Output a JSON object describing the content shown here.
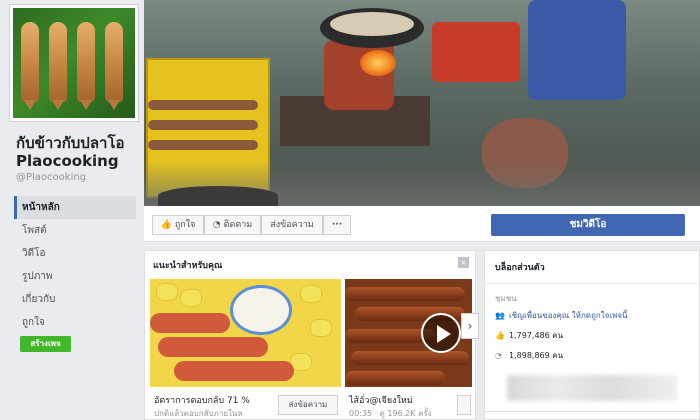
{
  "page": {
    "title": "กับข้าวกับปลาโอ Plaocooking",
    "handle": "@Plaocooking"
  },
  "sidebar": {
    "items": [
      {
        "label": "หน้าหลัก",
        "active": true
      },
      {
        "label": "โพสต์",
        "active": false
      },
      {
        "label": "วิดีโอ",
        "active": false
      },
      {
        "label": "รูปภาพ",
        "active": false
      },
      {
        "label": "เกี่ยวกับ",
        "active": false
      },
      {
        "label": "ถูกใจ",
        "active": false
      }
    ],
    "create_page": "สร้างเพจ"
  },
  "actions": {
    "like": "ถูกใจ",
    "follow": "ติดตาม",
    "message": "ส่งข้อความ",
    "more": "···",
    "watch_video": "ชมวิดีโอ"
  },
  "suggested": {
    "title": "แนะนำสำหรับคุณ",
    "close": "×",
    "videos": [
      {
        "title": "อัตราการตอบกลับ 71 %",
        "sub": "ปกติแล้วตอบกลับภายในห",
        "button": "ส่งข้อความ"
      },
      {
        "title": "ไส้อั่ว@เจียงใหม่",
        "sub": "00:35 · ดู 196.2K ครั้ง"
      }
    ]
  },
  "side": {
    "title": "บล็อกส่วนตัว",
    "section": "ชุมชน",
    "invite": "เชิญเพื่อนของคุณ ให้กดถูกใจเพจนี้",
    "likes": "1,797,486 คน",
    "follows": "1,898,869 คน"
  },
  "colors": {
    "facebook_blue": "#4267b2",
    "create_green": "#42b72a",
    "background": "#e9ebee"
  },
  "icons": {
    "like": "thumbs-up-icon",
    "follow": "rss-icon",
    "invite": "people-icon",
    "likes": "thumbs-up-icon",
    "follows": "rss-icon",
    "close": "close-icon",
    "play": "play-icon",
    "next": "chevron-right-icon"
  }
}
